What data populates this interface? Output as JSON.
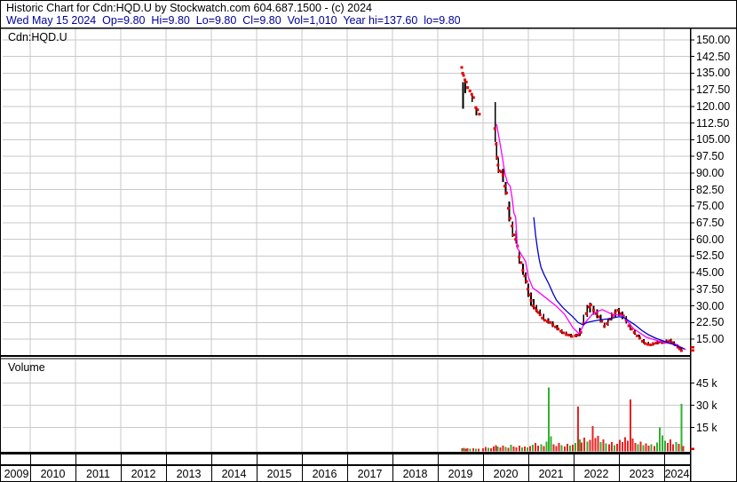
{
  "header": {
    "line1": "Historic Chart for Cdn:HQD.U by Stockwatch.com 604.687.1500 - (c) 2024",
    "line2": "Wed May 15 2024  Op=9.80  Hi=9.80  Lo=9.80  Cl=9.80  Vol=1,010  Year hi=137.60  lo=9.80"
  },
  "price_panel": {
    "label": "Cdn:HQD.U"
  },
  "volume_panel": {
    "label": "Volume"
  },
  "colors": {
    "quote_line_text": "#000099",
    "grid": "#c9c9c9",
    "ohlc_bar": "#000000",
    "close_dot": "#e00000",
    "ma_fast": "#ff00ff",
    "ma_slow": "#0000cc",
    "volume_up": "#2eb22e",
    "volume_down": "#ea2222",
    "axis_marker": "#e00000"
  },
  "chart_data": {
    "type": "ohlc",
    "title": "Historic Chart for Cdn:HQD.U",
    "symbol": "Cdn:HQD.U",
    "x_tick_labels": [
      "2009",
      "2010",
      "2011",
      "2012",
      "2013",
      "2014",
      "2015",
      "2016",
      "2017",
      "2018",
      "2019",
      "2020",
      "2021",
      "2022",
      "2023",
      "2024"
    ],
    "x_range_years": [
      2009,
      2024.55
    ],
    "price_axis": {
      "min": 15,
      "max": 150,
      "tick_step": 7.5,
      "labels": [
        "150.00",
        "142.50",
        "135.00",
        "127.50",
        "120.00",
        "112.50",
        "105.00",
        "97.50",
        "90.00",
        "82.50",
        "75.00",
        "67.50",
        "60.00",
        "52.50",
        "45.00",
        "37.50",
        "30.00",
        "22.50",
        "15.00"
      ]
    },
    "volume_axis": {
      "unit": "k",
      "labels": [
        "45 k",
        "30 k",
        "15 k"
      ],
      "tick_values_k": [
        45,
        30,
        15
      ]
    },
    "grid": true,
    "legend": false,
    "series": {
      "ohlc_bars_year_high_low": [
        [
          2019.56,
          131,
          119
        ],
        [
          2019.61,
          132,
          126
        ],
        [
          2019.76,
          126,
          122
        ],
        [
          2019.85,
          120,
          116
        ],
        [
          2020.27,
          122,
          104
        ],
        [
          2020.3,
          104,
          96
        ],
        [
          2020.34,
          97,
          90
        ],
        [
          2020.44,
          92,
          86
        ],
        [
          2020.5,
          86,
          80
        ],
        [
          2020.58,
          77,
          68
        ],
        [
          2020.65,
          68,
          61
        ],
        [
          2020.73,
          64,
          58
        ],
        [
          2020.8,
          55,
          49
        ],
        [
          2020.88,
          49,
          44
        ],
        [
          2020.94,
          45,
          40
        ],
        [
          2021.0,
          40,
          34
        ],
        [
          2021.06,
          36,
          30
        ],
        [
          2021.12,
          33,
          28.5
        ],
        [
          2021.18,
          30.5,
          27
        ],
        [
          2021.26,
          28.5,
          25.5
        ],
        [
          2021.34,
          26.5,
          23.5
        ],
        [
          2021.44,
          24.5,
          22
        ],
        [
          2021.54,
          23,
          20.5
        ],
        [
          2021.64,
          21.5,
          19
        ],
        [
          2021.74,
          19.5,
          17.5
        ],
        [
          2021.84,
          18.5,
          16.5
        ],
        [
          2021.94,
          17.5,
          15.8
        ],
        [
          2022.06,
          17.5,
          15.8
        ],
        [
          2022.14,
          20,
          16.5
        ],
        [
          2022.22,
          26,
          21
        ],
        [
          2022.3,
          30.5,
          25
        ],
        [
          2022.36,
          31.5,
          27
        ],
        [
          2022.44,
          30,
          26
        ],
        [
          2022.52,
          28.5,
          24.5
        ],
        [
          2022.6,
          26,
          22.5
        ],
        [
          2022.68,
          22.5,
          20
        ],
        [
          2022.76,
          24,
          21
        ],
        [
          2022.84,
          27,
          23.5
        ],
        [
          2022.92,
          28.5,
          25
        ],
        [
          2023.0,
          29,
          25.5
        ],
        [
          2023.08,
          27.5,
          24
        ],
        [
          2023.16,
          25.5,
          22
        ],
        [
          2023.25,
          22,
          19
        ],
        [
          2023.35,
          19.5,
          17
        ],
        [
          2023.45,
          17,
          14.8
        ],
        [
          2023.55,
          15,
          13
        ],
        [
          2023.65,
          13.8,
          12.2
        ],
        [
          2023.75,
          13.5,
          12
        ],
        [
          2023.85,
          14.2,
          12.6
        ],
        [
          2023.95,
          14.5,
          12.8
        ],
        [
          2024.05,
          14.8,
          13
        ],
        [
          2024.15,
          15.2,
          13.2
        ],
        [
          2024.22,
          14,
          12.2
        ],
        [
          2024.3,
          12.5,
          11
        ],
        [
          2024.37,
          11.2,
          9.8
        ]
      ],
      "close_dots_year_price": [
        [
          2019.53,
          137.6
        ],
        [
          2019.55,
          135
        ],
        [
          2019.57,
          134
        ],
        [
          2019.6,
          132
        ],
        [
          2019.63,
          131
        ],
        [
          2019.66,
          128.5
        ],
        [
          2019.71,
          127
        ],
        [
          2019.75,
          125.5
        ],
        [
          2019.79,
          124
        ],
        [
          2019.84,
          119.5
        ],
        [
          2019.88,
          118.5
        ],
        [
          2019.92,
          116.5
        ],
        [
          2020.26,
          110
        ],
        [
          2020.29,
          103
        ],
        [
          2020.31,
          97
        ],
        [
          2020.33,
          93.5
        ],
        [
          2020.36,
          91
        ],
        [
          2020.4,
          90.5
        ],
        [
          2020.44,
          89
        ],
        [
          2020.48,
          84
        ],
        [
          2020.52,
          81
        ],
        [
          2020.56,
          74
        ],
        [
          2020.6,
          69.5
        ],
        [
          2020.64,
          66
        ],
        [
          2020.68,
          62
        ],
        [
          2020.72,
          60
        ],
        [
          2020.76,
          57
        ],
        [
          2020.8,
          52
        ],
        [
          2020.84,
          49.5
        ],
        [
          2020.88,
          46
        ],
        [
          2020.92,
          43.5
        ],
        [
          2020.96,
          41
        ],
        [
          2020.99,
          37.5
        ],
        [
          2021.03,
          35
        ],
        [
          2021.06,
          32.5
        ],
        [
          2021.1,
          30
        ],
        [
          2021.14,
          29
        ],
        [
          2021.18,
          28
        ],
        [
          2021.22,
          27
        ],
        [
          2021.26,
          26
        ],
        [
          2021.31,
          24.5
        ],
        [
          2021.36,
          23.5
        ],
        [
          2021.42,
          23
        ],
        [
          2021.48,
          22.5
        ],
        [
          2021.54,
          21.5
        ],
        [
          2021.6,
          20.5
        ],
        [
          2021.66,
          19.5
        ],
        [
          2021.72,
          18.5
        ],
        [
          2021.78,
          17.8
        ],
        [
          2021.84,
          17
        ],
        [
          2021.9,
          16.8
        ],
        [
          2021.96,
          16.2
        ],
        [
          2022.04,
          16.5
        ],
        [
          2022.1,
          16.8
        ],
        [
          2022.16,
          18
        ],
        [
          2022.22,
          22
        ],
        [
          2022.28,
          26.5
        ],
        [
          2022.34,
          29.5
        ],
        [
          2022.38,
          30.5
        ],
        [
          2022.44,
          28
        ],
        [
          2022.5,
          26.5
        ],
        [
          2022.56,
          25
        ],
        [
          2022.62,
          23
        ],
        [
          2022.68,
          20.8
        ],
        [
          2022.74,
          22
        ],
        [
          2022.8,
          24
        ],
        [
          2022.86,
          25.5
        ],
        [
          2022.92,
          27
        ],
        [
          2022.98,
          28
        ],
        [
          2023.04,
          26.5
        ],
        [
          2023.1,
          25.5
        ],
        [
          2023.16,
          23.5
        ],
        [
          2023.22,
          21
        ],
        [
          2023.28,
          19.5
        ],
        [
          2023.34,
          18
        ],
        [
          2023.4,
          16.5
        ],
        [
          2023.46,
          15.5
        ],
        [
          2023.52,
          14
        ],
        [
          2023.58,
          13
        ],
        [
          2023.64,
          12.6
        ],
        [
          2023.7,
          12.4
        ],
        [
          2023.76,
          12.8
        ],
        [
          2023.82,
          13.2
        ],
        [
          2023.88,
          13.6
        ],
        [
          2023.94,
          13.8
        ],
        [
          2024.0,
          13.5
        ],
        [
          2024.06,
          13.8
        ],
        [
          2024.12,
          14.2
        ],
        [
          2024.18,
          13.4
        ],
        [
          2024.24,
          12.4
        ],
        [
          2024.3,
          11.4
        ],
        [
          2024.34,
          10.6
        ],
        [
          2024.38,
          9.8
        ]
      ],
      "ma_fast_magenta_year_price": [
        [
          2020.3,
          112
        ],
        [
          2020.36,
          105
        ],
        [
          2020.42,
          98
        ],
        [
          2020.48,
          90
        ],
        [
          2020.54,
          85.5
        ],
        [
          2020.6,
          84
        ],
        [
          2020.64,
          79
        ],
        [
          2020.68,
          72
        ],
        [
          2020.72,
          70
        ],
        [
          2020.76,
          56
        ],
        [
          2020.82,
          54
        ],
        [
          2020.88,
          52
        ],
        [
          2020.94,
          50
        ],
        [
          2021.0,
          43
        ],
        [
          2021.1,
          38
        ],
        [
          2021.2,
          36.6
        ],
        [
          2021.4,
          33.4
        ],
        [
          2021.6,
          30.2
        ],
        [
          2021.8,
          26.2
        ],
        [
          2021.98,
          20.2
        ],
        [
          2022.12,
          17.4
        ],
        [
          2022.24,
          22.1
        ],
        [
          2022.43,
          26.6
        ],
        [
          2022.63,
          28.3
        ],
        [
          2022.84,
          26.3
        ],
        [
          2023.08,
          25.5
        ],
        [
          2023.33,
          19.6
        ],
        [
          2023.61,
          15.8
        ],
        [
          2024.0,
          13.4
        ],
        [
          2024.25,
          12.6
        ],
        [
          2024.48,
          10.2
        ]
      ],
      "ma_slow_blue_year_price": [
        [
          2021.12,
          70
        ],
        [
          2021.16,
          62
        ],
        [
          2021.2,
          56
        ],
        [
          2021.24,
          51
        ],
        [
          2021.28,
          47.4
        ],
        [
          2021.35,
          44
        ],
        [
          2021.45,
          40
        ],
        [
          2021.55,
          35.4
        ],
        [
          2021.62,
          32.6
        ],
        [
          2021.75,
          29.5
        ],
        [
          2021.85,
          27.5
        ],
        [
          2021.98,
          25.1
        ],
        [
          2022.1,
          22.5
        ],
        [
          2022.2,
          21.5
        ],
        [
          2022.3,
          22.5
        ],
        [
          2022.43,
          23.1
        ],
        [
          2022.6,
          23.7
        ],
        [
          2022.8,
          24.2
        ],
        [
          2023.0,
          25.1
        ],
        [
          2023.1,
          24.8
        ],
        [
          2023.2,
          23.5
        ],
        [
          2023.35,
          21.5
        ],
        [
          2023.5,
          19
        ],
        [
          2023.65,
          17
        ],
        [
          2023.8,
          15.5
        ],
        [
          2024.0,
          14
        ],
        [
          2024.15,
          13
        ],
        [
          2024.3,
          11.8
        ],
        [
          2024.45,
          10.5
        ]
      ],
      "volume_year_valuek_updown": [
        [
          2019.54,
          0.8,
          "r"
        ],
        [
          2019.58,
          1.2,
          "g"
        ],
        [
          2019.62,
          0.6,
          "r"
        ],
        [
          2019.66,
          1.0,
          "r"
        ],
        [
          2019.72,
          0.5,
          "g"
        ],
        [
          2019.78,
          0.9,
          "r"
        ],
        [
          2019.84,
          0.7,
          "g"
        ],
        [
          2019.9,
          0.6,
          "r"
        ],
        [
          2020.0,
          1.0,
          "r"
        ],
        [
          2020.06,
          1.8,
          "r"
        ],
        [
          2020.12,
          1.2,
          "g"
        ],
        [
          2020.18,
          0.9,
          "r"
        ],
        [
          2020.24,
          2.2,
          "r"
        ],
        [
          2020.28,
          3.0,
          "r"
        ],
        [
          2020.32,
          2.0,
          "g"
        ],
        [
          2020.38,
          1.5,
          "r"
        ],
        [
          2020.44,
          2.6,
          "r"
        ],
        [
          2020.5,
          1.8,
          "g"
        ],
        [
          2020.56,
          1.2,
          "r"
        ],
        [
          2020.62,
          3.4,
          "g"
        ],
        [
          2020.68,
          2.2,
          "r"
        ],
        [
          2020.74,
          1.6,
          "r"
        ],
        [
          2020.8,
          2.8,
          "r"
        ],
        [
          2020.86,
          1.4,
          "g"
        ],
        [
          2020.92,
          2.0,
          "r"
        ],
        [
          2020.98,
          1.6,
          "g"
        ],
        [
          2021.04,
          2.4,
          "r"
        ],
        [
          2021.1,
          3.2,
          "g"
        ],
        [
          2021.16,
          4.6,
          "r"
        ],
        [
          2021.22,
          2.8,
          "r"
        ],
        [
          2021.28,
          3.6,
          "g"
        ],
        [
          2021.34,
          2.4,
          "r"
        ],
        [
          2021.4,
          5.5,
          "g"
        ],
        [
          2021.45,
          42,
          "g"
        ],
        [
          2021.5,
          9.0,
          "g"
        ],
        [
          2021.56,
          3.5,
          "r"
        ],
        [
          2021.62,
          2.5,
          "r"
        ],
        [
          2021.68,
          4.5,
          "r"
        ],
        [
          2021.74,
          3.0,
          "g"
        ],
        [
          2021.8,
          2.2,
          "r"
        ],
        [
          2021.86,
          3.8,
          "r"
        ],
        [
          2021.92,
          2.6,
          "g"
        ],
        [
          2021.98,
          3.2,
          "r"
        ],
        [
          2022.04,
          4.5,
          "g"
        ],
        [
          2022.1,
          29,
          "r"
        ],
        [
          2022.14,
          7.0,
          "g"
        ],
        [
          2022.18,
          4.8,
          "r"
        ],
        [
          2022.24,
          8.2,
          "r"
        ],
        [
          2022.3,
          5.5,
          "g"
        ],
        [
          2022.36,
          6.5,
          "r"
        ],
        [
          2022.42,
          16,
          "r"
        ],
        [
          2022.48,
          7.8,
          "r"
        ],
        [
          2022.54,
          9.2,
          "r"
        ],
        [
          2022.6,
          5.0,
          "g"
        ],
        [
          2022.66,
          6.8,
          "r"
        ],
        [
          2022.72,
          4.2,
          "g"
        ],
        [
          2022.78,
          3.5,
          "r"
        ],
        [
          2022.84,
          5.2,
          "r"
        ],
        [
          2022.9,
          3.0,
          "g"
        ],
        [
          2022.96,
          4.0,
          "r"
        ],
        [
          2023.02,
          6.5,
          "r"
        ],
        [
          2023.08,
          5.0,
          "r"
        ],
        [
          2023.14,
          8.5,
          "r"
        ],
        [
          2023.2,
          6.0,
          "r"
        ],
        [
          2023.25,
          34,
          "r"
        ],
        [
          2023.3,
          7.5,
          "r"
        ],
        [
          2023.36,
          4.5,
          "r"
        ],
        [
          2023.42,
          3.5,
          "g"
        ],
        [
          2023.48,
          5.5,
          "r"
        ],
        [
          2023.54,
          3.0,
          "g"
        ],
        [
          2023.6,
          4.2,
          "r"
        ],
        [
          2023.66,
          2.8,
          "r"
        ],
        [
          2023.72,
          3.6,
          "g"
        ],
        [
          2023.78,
          2.5,
          "r"
        ],
        [
          2023.84,
          4.8,
          "g"
        ],
        [
          2023.9,
          15,
          "g"
        ],
        [
          2023.96,
          9.5,
          "g"
        ],
        [
          2024.02,
          6.0,
          "g"
        ],
        [
          2024.08,
          4.5,
          "r"
        ],
        [
          2024.14,
          7.0,
          "r"
        ],
        [
          2024.2,
          3.5,
          "r"
        ],
        [
          2024.26,
          5.0,
          "g"
        ],
        [
          2024.32,
          4.0,
          "r"
        ],
        [
          2024.38,
          31,
          "g"
        ],
        [
          2024.42,
          2.5,
          "r"
        ]
      ]
    }
  }
}
